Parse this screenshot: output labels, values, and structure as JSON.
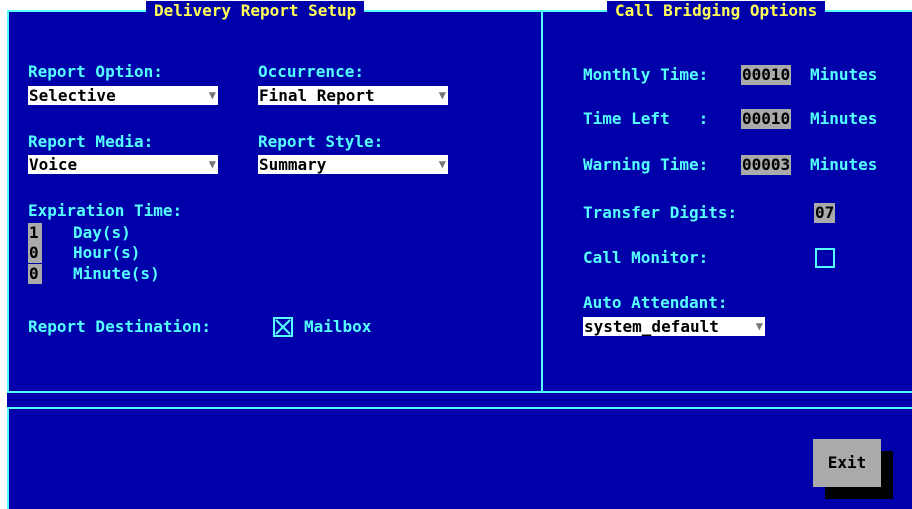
{
  "delivery": {
    "title": "Delivery Report Setup",
    "report_option_label": "Report Option:",
    "report_option_value": "Selective",
    "occurrence_label": "Occurrence:",
    "occurrence_value": "Final Report",
    "report_media_label": "Report Media:",
    "report_media_value": "Voice",
    "report_style_label": "Report Style:",
    "report_style_value": "Summary",
    "expiration_label": "Expiration Time:",
    "days_value": "1",
    "days_label": "Day(s)",
    "hours_value": "0",
    "hours_label": "Hour(s)",
    "minutes_value": "0",
    "minutes_label": "Minute(s)",
    "destination_label": "Report Destination:",
    "mailbox_label": "Mailbox",
    "mailbox_checked": true
  },
  "bridging": {
    "title": "Call Bridging Options",
    "monthly_label": "Monthly Time:",
    "monthly_value": "00010",
    "monthly_unit": "Minutes",
    "timeleft_label": "Time Left   :",
    "timeleft_value": "00010",
    "timeleft_unit": "Minutes",
    "warning_label": "Warning Time:",
    "warning_value": "00003",
    "warning_unit": "Minutes",
    "transfer_label": "Transfer Digits:",
    "transfer_value": "07",
    "monitor_label": "Call Monitor:",
    "monitor_checked": false,
    "attendant_label": "Auto Attendant:",
    "attendant_value": "system_default"
  },
  "footer": {
    "exit_label": "Exit"
  },
  "colors": {
    "background": "#0000aa",
    "label": "#55ffff",
    "title": "#ffff55",
    "field": "#ffffff",
    "button": "#aaaaaa"
  },
  "icons": {
    "dropdown": "down-triangle",
    "checkbox_checked": "x-box"
  }
}
